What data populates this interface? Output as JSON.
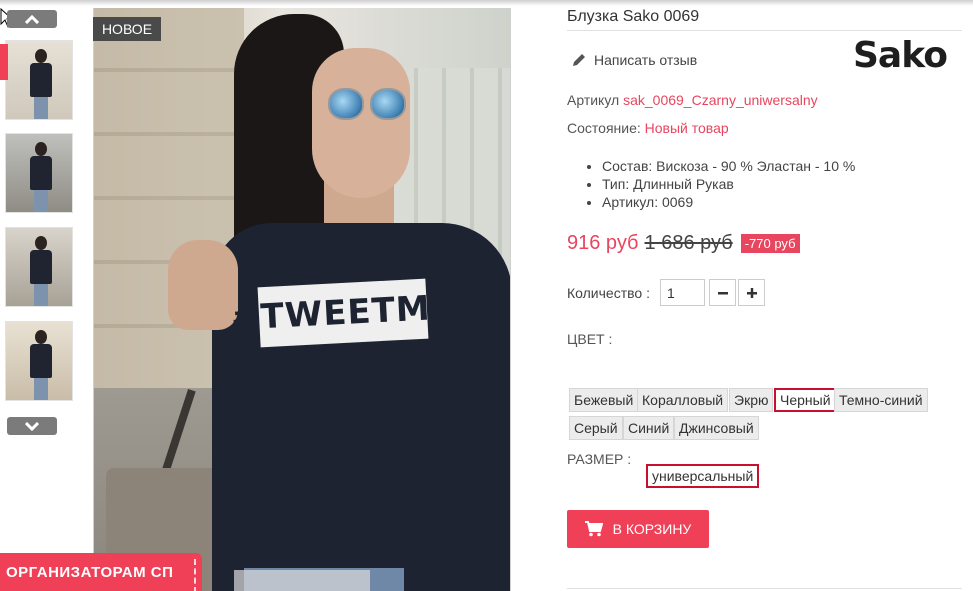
{
  "badge": {
    "new": "НОВОЕ"
  },
  "product": {
    "title": "Блузка Sako 0069",
    "review_link": "Написать отзыв",
    "brand_logo": "Sako",
    "article_label": "Артикул",
    "article_value": "sak_0069_Czarny_uniwersalny",
    "condition_label": "Состояние:",
    "condition_value": "Новый товар",
    "specs": [
      "Состав: Вискоза - 90 % Эластан - 10 %",
      "Тип: Длинный Рукав",
      "Артикул: 0069"
    ],
    "print_text": "#TWEETME"
  },
  "price": {
    "current": "916 руб",
    "old": "1 686 руб",
    "discount": "-770 руб"
  },
  "quantity": {
    "label": "Количество :",
    "value": "1"
  },
  "color": {
    "label": "ЦВЕТ :",
    "options": [
      "Бежевый",
      "Коралловый",
      "Экрю",
      "Черный",
      "Темно-синий",
      "Серый",
      "Синий",
      "Джинсовый"
    ],
    "selected": "Черный"
  },
  "size": {
    "label": "РАЗМЕР :",
    "options": [
      "универсальный"
    ],
    "selected": "универсальный"
  },
  "cart": {
    "label": "В КОРЗИНУ"
  },
  "banner": {
    "label": "ОРГАНИЗАТОРАМ СП"
  },
  "icons": {
    "review": "pencil-icon",
    "cart": "cart-icon",
    "thumb_up": "chevron-up-icon",
    "thumb_down": "chevron-down-icon",
    "qty_minus": "minus-icon",
    "qty_plus": "plus-icon"
  },
  "colors": {
    "accent": "#f04058",
    "price": "#e8455f",
    "selected_border": "#c8102e"
  }
}
